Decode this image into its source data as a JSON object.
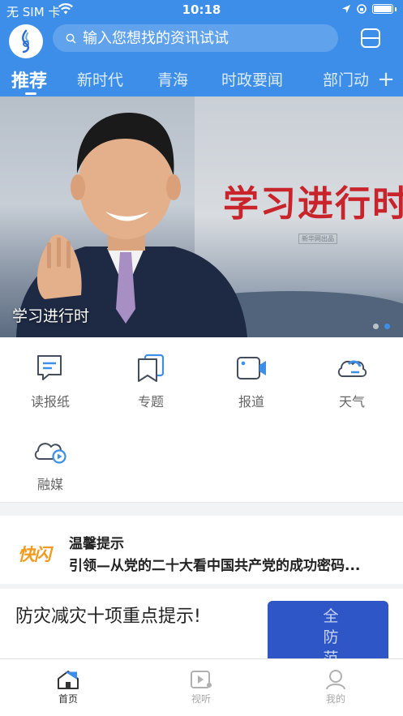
{
  "status_bar": {
    "carrier": "无 SIM 卡",
    "time": "10:18"
  },
  "search": {
    "placeholder": "输入您想找的资讯试试"
  },
  "tabs": [
    {
      "label": "推荐",
      "active": true
    },
    {
      "label": "新时代",
      "active": false
    },
    {
      "label": "青海",
      "active": false
    },
    {
      "label": "时政要闻",
      "active": false
    },
    {
      "label": "部门动态",
      "active": false
    }
  ],
  "tab_add_label": "+",
  "banner": {
    "headline": "学习进行时",
    "seal": "新华网出品",
    "caption": "学习进行时",
    "page_count": 2,
    "active_page": 2
  },
  "shortcuts": [
    {
      "label": "读报纸",
      "icon": "newspaper-icon"
    },
    {
      "label": "专题",
      "icon": "topic-icon"
    },
    {
      "label": "报道",
      "icon": "video-report-icon"
    },
    {
      "label": "天气",
      "icon": "weather-icon"
    },
    {
      "label": "融媒",
      "icon": "media-cloud-icon"
    }
  ],
  "flash_news": {
    "badge": "快闪",
    "title": "温馨提示",
    "text": "引领—从党的二十大看中国共产党的成功密码..."
  },
  "news": {
    "title": "防灾减灾十项重点提示!",
    "thumb_text": "全防范"
  },
  "tabbar": [
    {
      "label": "首页",
      "icon": "home-icon",
      "active": true
    },
    {
      "label": "视听",
      "icon": "video-play-icon",
      "active": false
    },
    {
      "label": "我的",
      "icon": "profile-icon",
      "active": false
    }
  ],
  "colors": {
    "brand_blue": "#3d8ee8",
    "flash_orange": "#f29a1e",
    "headline_red": "#c9242b"
  }
}
